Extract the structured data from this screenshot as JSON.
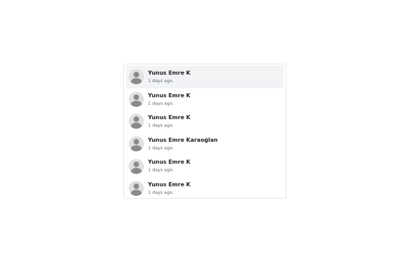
{
  "notifications": {
    "items": [
      {
        "name": "Yunus Emre K",
        "time": "1 days ago.",
        "icon": "user-avatar-icon",
        "active": true
      },
      {
        "name": "Yunus Emre K",
        "time": "1 days ago.",
        "icon": "user-avatar-icon",
        "active": false
      },
      {
        "name": "Yunus Emre K",
        "time": "1 days ago.",
        "icon": "user-avatar-icon",
        "active": false
      },
      {
        "name": "Yunus Emre Karaoğlan",
        "time": "1 days ago.",
        "icon": "user-avatar-icon",
        "active": false
      },
      {
        "name": "Yunus Emre K",
        "time": "1 days ago.",
        "icon": "user-avatar-icon",
        "active": false
      },
      {
        "name": "Yunus Emre K",
        "time": "1 days ago.",
        "icon": "user-avatar-icon",
        "active": false
      }
    ]
  },
  "colors": {
    "hover_background": "#f2f3f5",
    "border": "#e6e6e6",
    "avatar_background": "#e0e0e0",
    "avatar_silhouette": "#8a8a8a",
    "name_text": "#1c1e21",
    "time_text": "#606770"
  }
}
